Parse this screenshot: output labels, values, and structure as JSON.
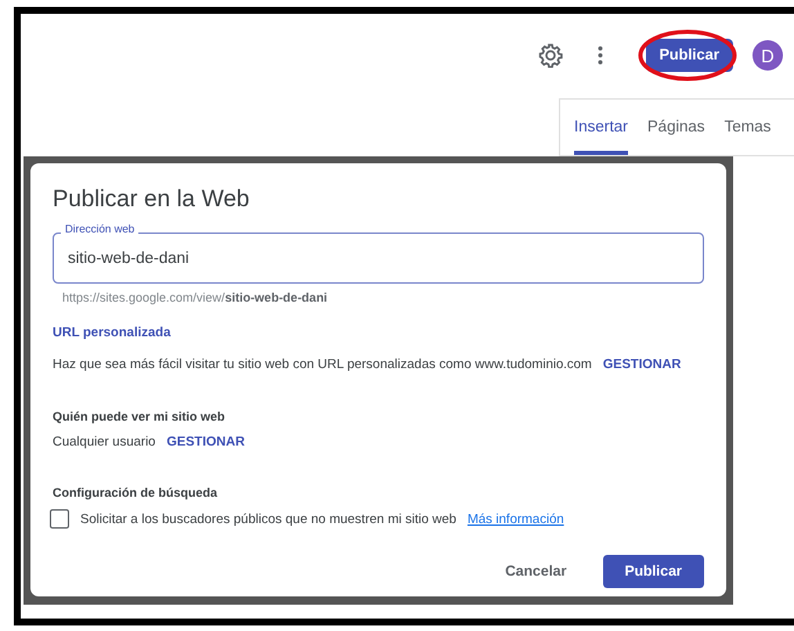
{
  "toolbar": {
    "publish_button": "Publicar",
    "avatar": "D"
  },
  "tabs": [
    {
      "label": "Insertar",
      "selected": true
    },
    {
      "label": "Páginas",
      "selected": false
    },
    {
      "label": "Temas",
      "selected": false
    }
  ],
  "dialog": {
    "title": "Publicar en la Web",
    "address_field": {
      "label": "Dirección web",
      "value": "sitio-web-de-dani"
    },
    "url_hint": "https://sites.google.com/view/**sitio-web-de-dani**",
    "custom_url": {
      "heading": "URL personalizada",
      "text": "Haz que sea más fácil visitar tu sitio web con URL personalizadas como www.tudominio.com",
      "action": "GESTIONAR"
    },
    "visibility": {
      "heading": "Quién puede ver mi sitio web",
      "value": "Cualquier usuario",
      "action": "GESTIONAR"
    },
    "search": {
      "heading": "Configuración de búsqueda",
      "checkbox": {
        "label": "Solicitar a los buscadores públicos que no muestren mi sitio web",
        "checked": false
      },
      "link": "Más información"
    },
    "buttons": [
      {
        "label": "Cancelar",
        "kind": "text"
      },
      {
        "label": "Publicar",
        "kind": "primary"
      }
    ]
  }
}
